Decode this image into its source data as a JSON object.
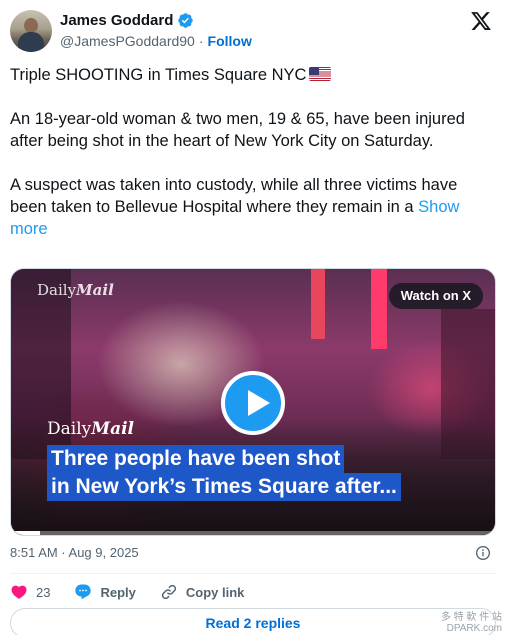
{
  "author": {
    "display_name": "James Goddard",
    "handle": "@JamesPGoddard90",
    "separator": "·",
    "follow_label": "Follow"
  },
  "tweet": {
    "line1": "Triple SHOOTING in Times Square NYC",
    "para2": "An 18-year-old woman & two men, 19 & 65, have been injured after being shot in the heart of New York City on Saturday.",
    "para3": "A suspect was taken into custody, while all three victims have been taken to Bellevue Hospital where they remain in a",
    "show_more": "Show more"
  },
  "media": {
    "watermark_top_light": "Daily",
    "watermark_top_bold": "Mail",
    "watch_label": "Watch on X",
    "caption_brand_light": "Daily",
    "caption_brand_bold": "Mail",
    "caption_line1": "Three people have been shot",
    "caption_line2": "in New York’s Times Square after...",
    "progress_fraction": 0.06
  },
  "timestamp": "8:51 AM · Aug 9, 2025",
  "actions": {
    "like_count": "23",
    "reply_label": "Reply",
    "copy_link_label": "Copy link"
  },
  "read_replies_label": "Read 2 replies",
  "site_watermark": {
    "line1": "多 特 軟 件 站",
    "line2": "DPARK.com"
  },
  "colors": {
    "accent": "#1d9bf0",
    "like": "#f91880",
    "caption_bg": "#1e57c8"
  }
}
